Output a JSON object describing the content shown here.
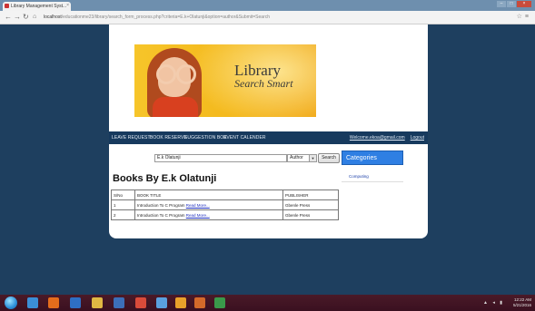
{
  "browser": {
    "tab_title": "Library Management Syst...",
    "tab_close": "×",
    "url_host": "localhost",
    "url_path": "/educationme23/library/search_form_process.php?criteria=E.k+Olatunji&option=author&Submit=Search",
    "window_controls": [
      "–",
      "□",
      "×"
    ]
  },
  "banner": {
    "logo_line1": "Library",
    "logo_line2": "Search Smart"
  },
  "nav": {
    "items": [
      "LEAVE REQUEST",
      "BOOK RESERVE",
      "SUGGESTION BOX",
      "EVENT CALENDER"
    ],
    "welcome_text": "Welcome.ekoa@gmail.com",
    "logout": "Logout"
  },
  "search": {
    "query": "E.k Olatunji",
    "option_selected": "Author",
    "button_label": "Search"
  },
  "results": {
    "heading": "Books By E.k Olatunji",
    "columns": [
      "S/No",
      "BOOK TITLE",
      "PUBLISHER"
    ],
    "rows": [
      {
        "sno": "1",
        "title": "Introduction To C Program",
        "read_more": "Read More...",
        "publisher": "Gbenle Press"
      },
      {
        "sno": "2",
        "title": "Introduction To C Program",
        "read_more": "Read More...",
        "publisher": "Gbenle Press"
      }
    ]
  },
  "sidebar": {
    "title": "Categories",
    "items": [
      "Computing"
    ]
  },
  "taskbar": {
    "time": "12:22 AM",
    "date": "5/21/2016"
  },
  "colors": {
    "desktop_bg": "#1e3f5f",
    "navbar_bg": "#173a5e",
    "categories_bg": "#2f7fe3",
    "link": "#2030c0"
  }
}
